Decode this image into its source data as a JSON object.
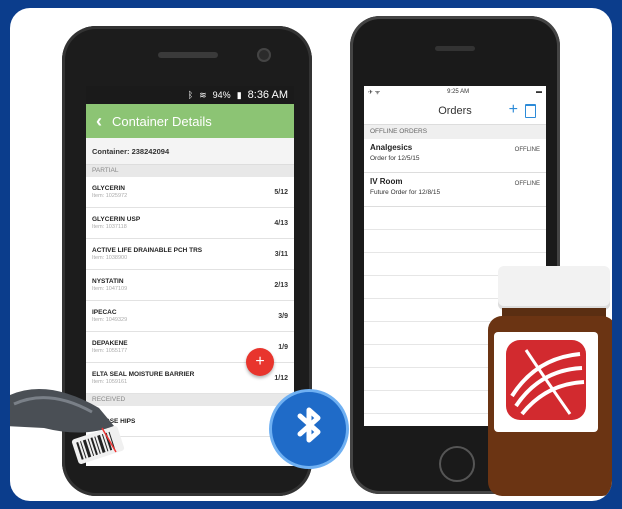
{
  "android": {
    "status": {
      "signal": "94%",
      "time": "8:36 AM"
    },
    "header": {
      "title": "Container Details"
    },
    "container_label": "Container: 238242094",
    "section_partial": "PARTIAL",
    "items": [
      {
        "name": "GLYCERIN",
        "item": "Item: 1025972",
        "count": "5/12"
      },
      {
        "name": "GLYCERIN USP",
        "item": "Item: 1037118",
        "count": "4/13"
      },
      {
        "name": "ACTIVE LIFE DRAINABLE PCH TRS",
        "item": "Item: 1038900",
        "count": "3/11"
      },
      {
        "name": "NYSTATIN",
        "item": "Item: 1047109",
        "count": "2/13"
      },
      {
        "name": "IPECAC",
        "item": "Item: 1049329",
        "count": "3/9"
      },
      {
        "name": "DEPAKENE",
        "item": "Item: 1055177",
        "count": "1/9"
      },
      {
        "name": "ELTA SEAL MOISTURE BARRIER",
        "item": "Item: 1059161",
        "count": "1/12"
      }
    ],
    "section_received": "RECEIVED",
    "partial_last": {
      "name": "W/ROSE HIPS",
      "count": "0/"
    },
    "fab": "+"
  },
  "iphone": {
    "status": {
      "left": "✈ ᯤ",
      "time": "9:25 AM"
    },
    "nav": {
      "title": "Orders",
      "plus": "+"
    },
    "section": "OFFLINE ORDERS",
    "orders": [
      {
        "title": "Analgesics",
        "subtitle": "Order for 12/5/15",
        "status": "OFFLINE"
      },
      {
        "title": "IV Room",
        "subtitle": "Future Order for 12/8/15",
        "status": "OFFLINE"
      }
    ]
  },
  "colors": {
    "background": "#0b3d8c",
    "android_header": "#8cc474",
    "fab": "#e8352d",
    "bluetooth": "#1f6bc8",
    "logo": "#d22a2f"
  }
}
